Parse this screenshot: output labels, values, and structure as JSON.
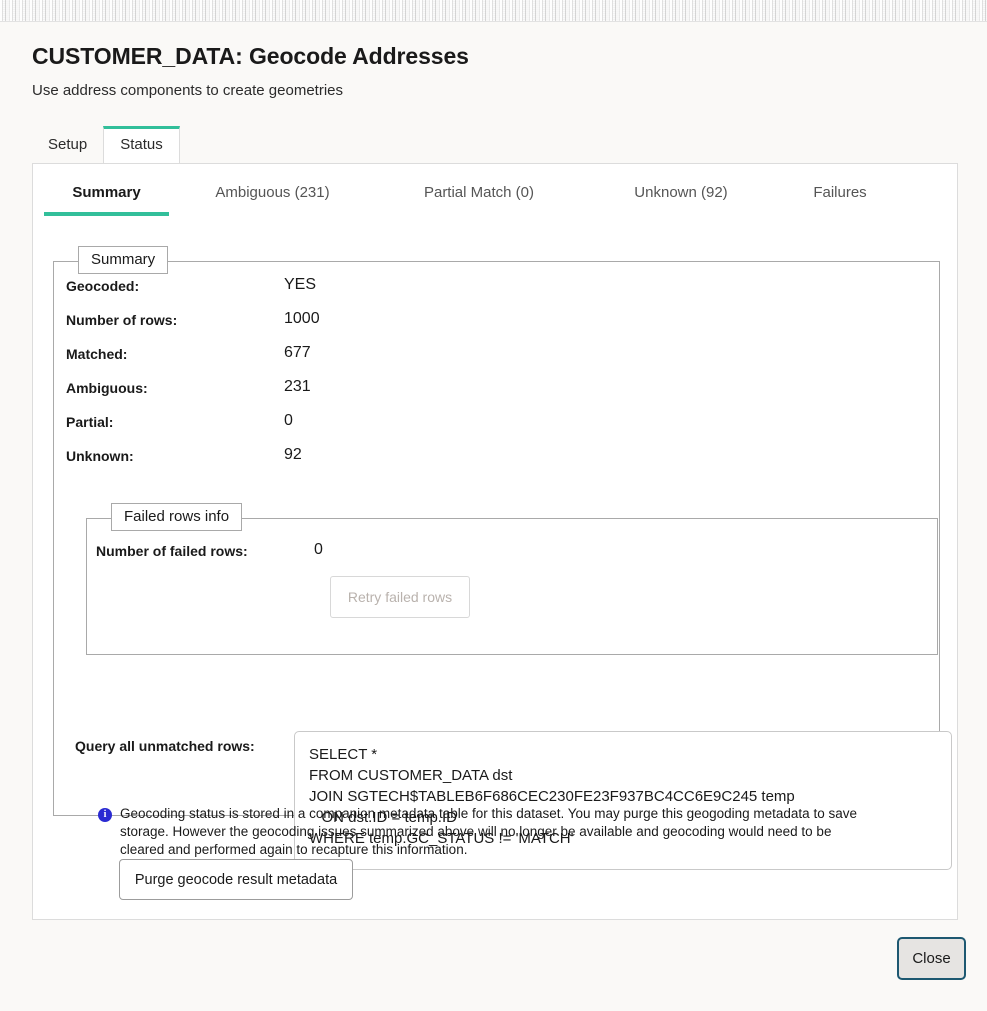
{
  "window": {
    "title": "CUSTOMER_DATA: Geocode Addresses",
    "subtitle": "Use address components to create geometries"
  },
  "outer_tabs": [
    {
      "label": "Setup",
      "active": false
    },
    {
      "label": "Status",
      "active": true
    }
  ],
  "inner_tabs": [
    {
      "label": "Summary",
      "active": true
    },
    {
      "label": "Ambiguous (231)",
      "active": false
    },
    {
      "label": "Partial Match (0)",
      "active": false
    },
    {
      "label": "Unknown (92)",
      "active": false
    },
    {
      "label": "Failures",
      "active": false
    }
  ],
  "summary": {
    "legend": "Summary",
    "rows": [
      {
        "label": "Geocoded:",
        "value": "YES"
      },
      {
        "label": "Number of rows:",
        "value": "1000"
      },
      {
        "label": "Matched:",
        "value": "677"
      },
      {
        "label": "Ambiguous:",
        "value": "231"
      },
      {
        "label": "Partial:",
        "value": "0"
      },
      {
        "label": "Unknown:",
        "value": "92"
      }
    ]
  },
  "failed_rows": {
    "legend": "Failed rows info",
    "label": "Number of failed rows:",
    "value": "0",
    "retry_button": "Retry failed rows"
  },
  "query": {
    "label": "Query all unmatched rows:",
    "sql": "SELECT *\nFROM CUSTOMER_DATA dst\nJOIN SGTECH$TABLEB6F686CEC230FE23F937BC4CC6E9C245 temp\n   ON dst.ID = temp.ID\nWHERE temp.GC_STATUS != 'MATCH'"
  },
  "notice": {
    "icon": "info-icon",
    "icon_glyph": "i",
    "text": "Geocoding status is stored in a companion metadata table for this dataset. You may purge this geogoding metadata to save storage. However the geocoding issues summarized above will no longer be available and geocoding would need to be cleared and performed again to recapture this information.",
    "purge_button": "Purge geocode result metadata"
  },
  "footer": {
    "close_button": "Close"
  },
  "colors": {
    "accent_teal": "#32bf9a",
    "page_background": "#faf9f7",
    "panel_background": "#ffffff",
    "info_icon_blue": "#2a2ad2",
    "close_border": "#1d5871"
  }
}
